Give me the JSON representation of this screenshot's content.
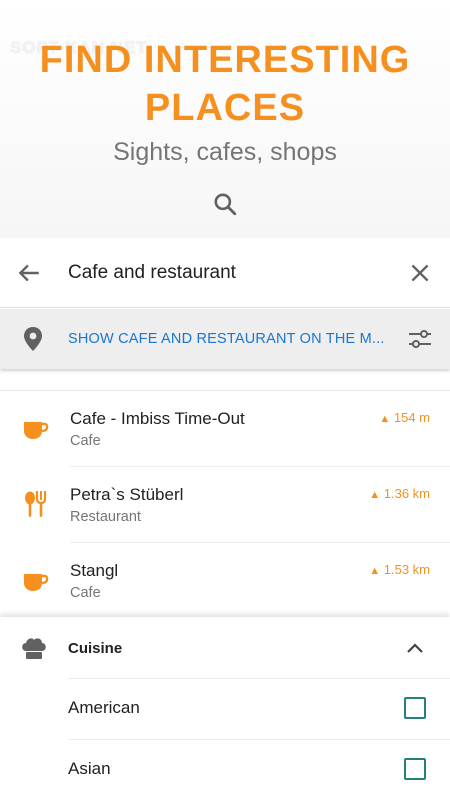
{
  "hero": {
    "watermark": "SOFT KAN NET",
    "title_line1": "FIND INTERESTING",
    "title_line2": "PLACES",
    "subtitle": "Sights, cafes, shops",
    "icon": "search-icon"
  },
  "search": {
    "query": "Cafe and restaurant",
    "back_icon": "back-arrow-icon",
    "clear_icon": "close-icon"
  },
  "map_bar": {
    "label": "SHOW CAFE AND RESTAURANT ON THE M...",
    "pin_icon": "location-pin-icon",
    "filter_icon": "filter-sliders-icon"
  },
  "places": [
    {
      "name": "Cafe - Imbiss Time-Out",
      "type": "Cafe",
      "distance": "154 m",
      "icon": "coffee-cup-icon"
    },
    {
      "name": "Petra`s Stüberl",
      "type": "Restaurant",
      "distance": "1.36 km",
      "icon": "fork-spoon-icon"
    },
    {
      "name": "Stangl",
      "type": "Cafe",
      "distance": "1.53 km",
      "icon": "coffee-cup-icon"
    }
  ],
  "filter": {
    "section_label": "Cuisine",
    "section_icon": "chef-hat-icon",
    "options": [
      {
        "label": "American",
        "checked": false
      },
      {
        "label": "Asian",
        "checked": false
      }
    ]
  },
  "colors": {
    "accent_orange": "#f5901e",
    "link_blue": "#1976d2",
    "checkbox_teal": "#26807a"
  }
}
